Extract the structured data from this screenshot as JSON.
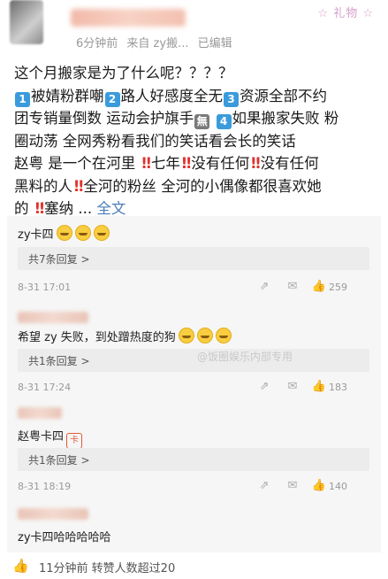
{
  "post": {
    "meta": {
      "time": "6分钟前",
      "source": "来自 zy搬...",
      "edited": "已编辑"
    },
    "badge_text": "☆ 礼物 ☆",
    "lines": {
      "l1": "这个月搬家是为了什么呢？？？？",
      "l2a": "1",
      "l2b": "被婧粉群嘲",
      "l2c": "2",
      "l2d": "路人好感度全无",
      "l2e": "3",
      "l2f": "资源全部不约",
      "l3a": "团专销量倒数 运动会护旗手",
      "l3b": "無",
      "l3c": "4",
      "l3d": "如果搬家失败 粉",
      "l4": "圈动荡 全网秀粉看我们的笑话看会长的笑话",
      "l5a": "赵粤 是一个在河里",
      "l5b": "七年",
      "l5c": "没有任何",
      "l5d": "没有任何",
      "l6a": "黑料的人",
      "l6b": "全河的粉丝 全河的小偶像都很喜欢她",
      "l7a": "的",
      "l7b": "塞纳 ...",
      "l7c": "全文"
    },
    "bang": "‼"
  },
  "comments": [
    {
      "text": "zy卡四",
      "reply": "共7条回复 >",
      "date": "8-31 17:01",
      "likes": "259"
    },
    {
      "text": "希望 zy 失败，到处蹭热度的狗",
      "reply": "共1条回复 >",
      "date": "8-31 17:24",
      "likes": "183"
    },
    {
      "text": "赵粤卡四",
      "reply": "共1条回复 >",
      "date": "8-31 18:19",
      "likes": "140"
    },
    {
      "text": "zy卡四哈哈哈哈哈"
    }
  ],
  "watermark": "@饭圈娱乐内部专用",
  "bottom": {
    "text": "11分钟前 转赞人数超过20"
  },
  "icons": {
    "share": "share-icon",
    "comment": "comment-icon",
    "like": "thumbs-up-icon"
  },
  "colors": {
    "accent_blue": "#3a9bdc",
    "bang_red": "#e0322b",
    "link": "#4a7db8"
  }
}
